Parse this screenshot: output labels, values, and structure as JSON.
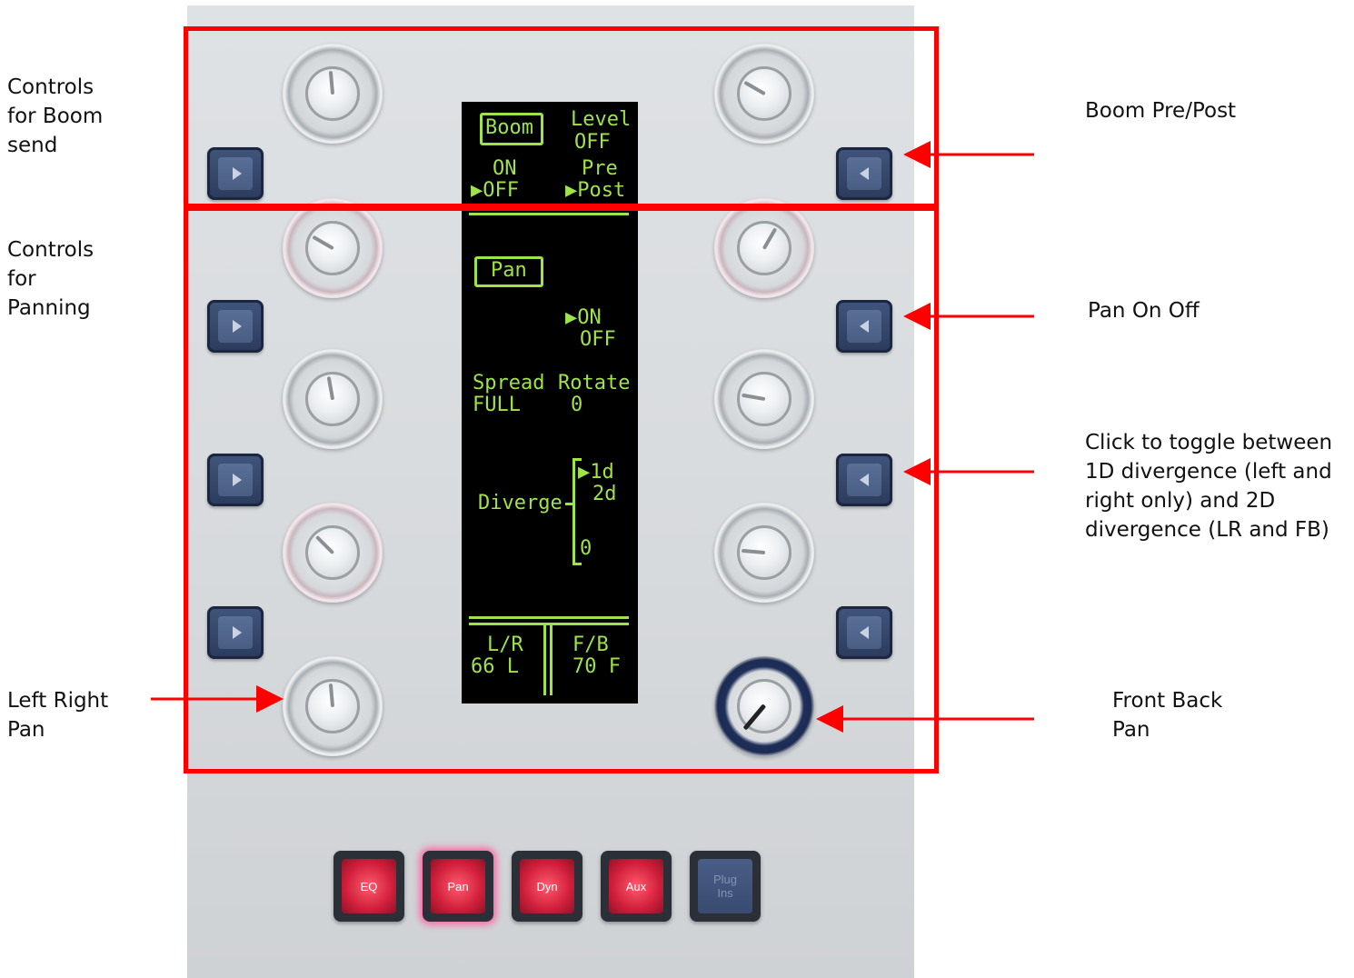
{
  "annotations": {
    "boom_send": "Controls\nfor Boom\nsend",
    "panning": "Controls\nfor\nPanning",
    "left_right_pan": "Left Right\nPan",
    "boom_pre_post": "Boom Pre/Post",
    "pan_on_off": "Pan On Off",
    "divergence_toggle": "Click to toggle between\n1D divergence (left and\nright only) and 2D\ndivergence (LR and FB)",
    "front_back_pan": "Front Back\nPan"
  },
  "display": {
    "boom_title": "Boom",
    "level_label": "Level",
    "level_value": "OFF",
    "boom_on": "ON",
    "boom_off": "▶OFF",
    "pre": "Pre",
    "post": "▶Post",
    "pan_title": "Pan",
    "pan_on": "▶ON",
    "pan_off": "OFF",
    "spread_label": "Spread",
    "spread_value": "FULL",
    "rotate_label": "Rotate",
    "rotate_value": "0",
    "diverge_label": "Diverge",
    "div_1d": "▶1d",
    "div_2d": "2d",
    "div_value": "0",
    "lr_label": "L/R",
    "lr_value": "66 L",
    "fb_label": "F/B",
    "fb_value": "70 F"
  },
  "mode_buttons": {
    "eq": "EQ",
    "pan": "Pan",
    "dyn": "Dyn",
    "aux": "Aux",
    "plugins": "Plug\nIns"
  },
  "colors": {
    "highlight": "#ff0000",
    "oled_text": "#9ee34a",
    "button_blue": "#2b3b5d",
    "mode_red": "#d11f3b"
  }
}
